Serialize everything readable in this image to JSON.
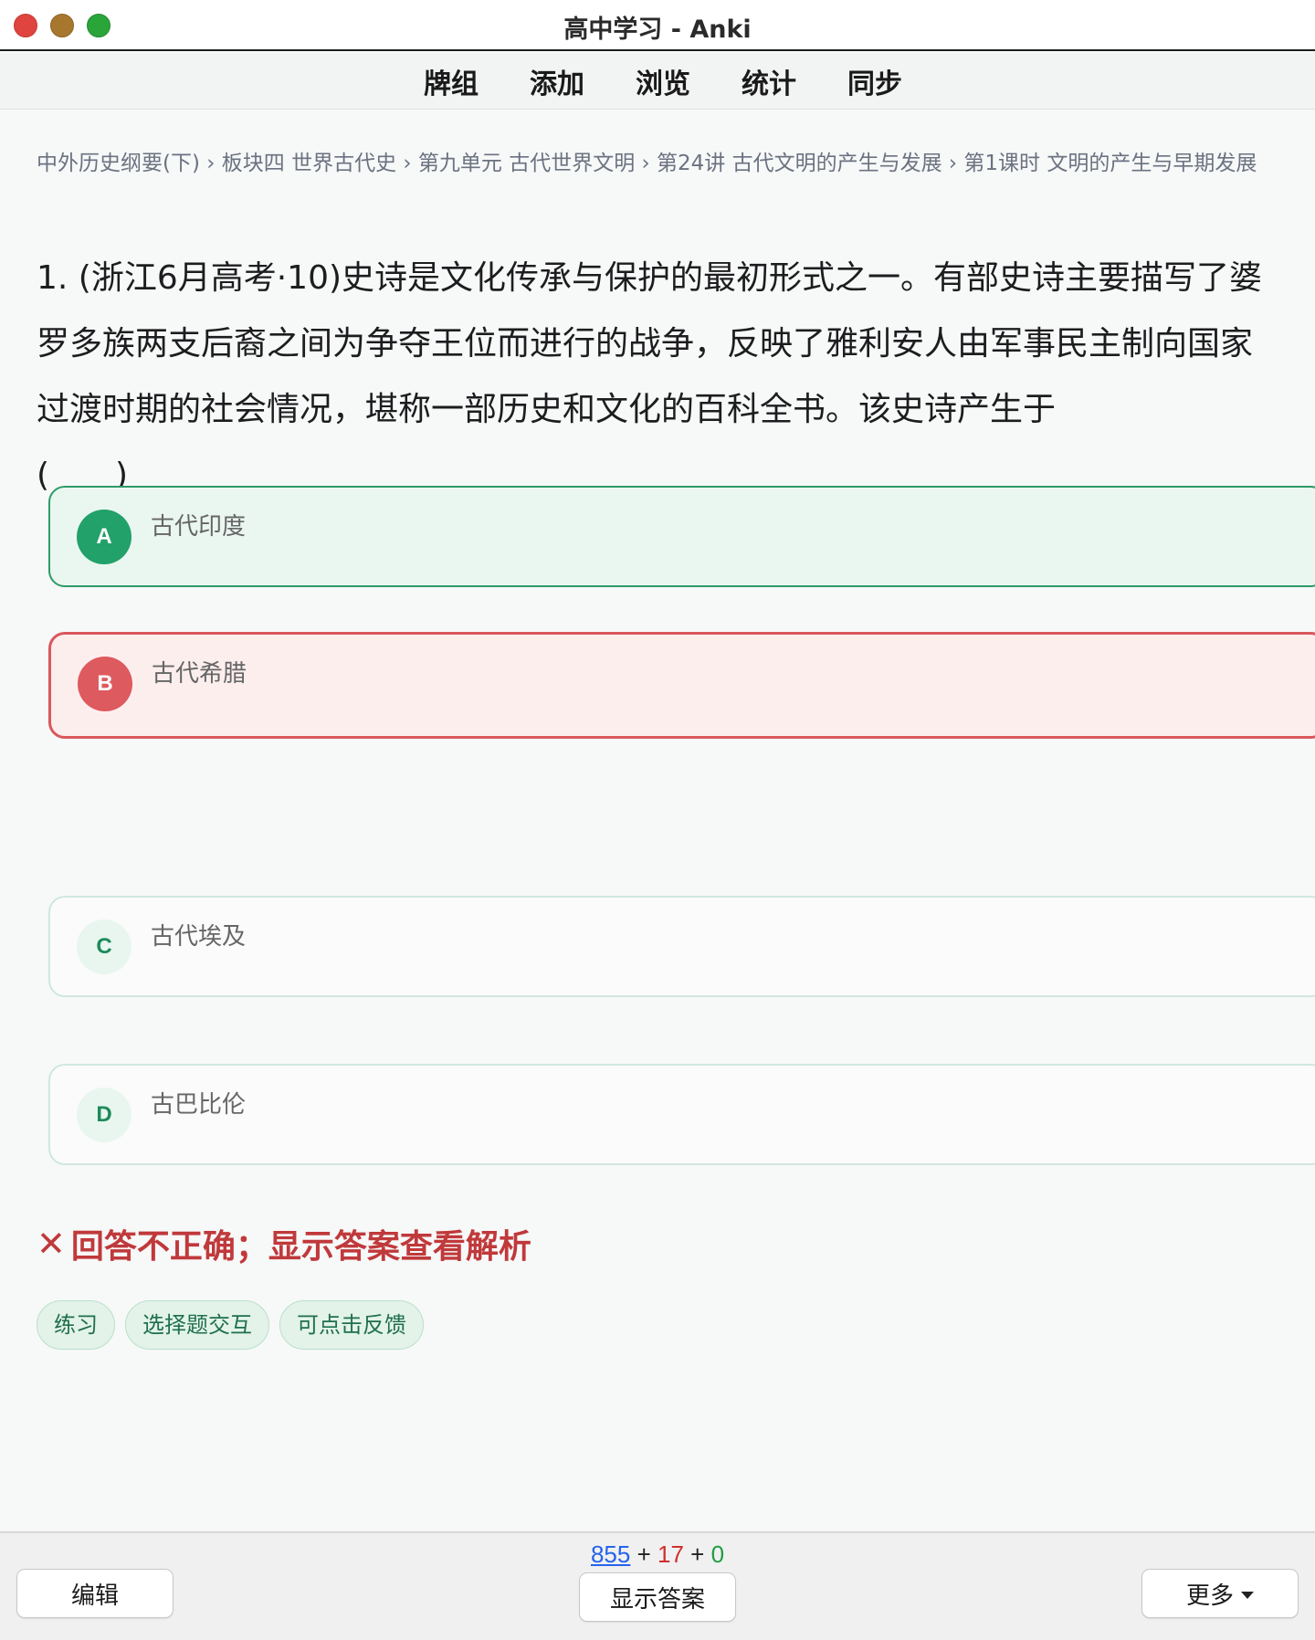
{
  "window": {
    "title": "高中学习 - Anki"
  },
  "toolbar": {
    "items": [
      "牌组",
      "添加",
      "浏览",
      "统计",
      "同步"
    ]
  },
  "breadcrumb": "中外历史纲要(下) › 板块四 世界古代史 › 第九单元 古代世界文明 › 第24讲 古代文明的产生与发展 › 第1课时 文明的产生与早期发展",
  "question": {
    "text": "1.  (浙江6月高考·10)史诗是文化传承与保护的最初形式之一。有部史诗主要描写了婆罗多族两支后裔之间为争夺王位而进行的战争，反映了雅利安人由军事民主制向国家过渡时期的社会情况，堪称一部历史和文化的百科全书。该史诗产生于",
    "blank": "(  )"
  },
  "options": [
    {
      "letter": "A",
      "text": "古代印度",
      "state": "correct"
    },
    {
      "letter": "B",
      "text": "古代希腊",
      "state": "wrong"
    },
    {
      "letter": "C",
      "text": "古代埃及",
      "state": "neutral"
    },
    {
      "letter": "D",
      "text": "古巴比伦",
      "state": "neutral"
    }
  ],
  "feedback": {
    "icon": "✕",
    "text": "回答不正确；显示答案查看解析",
    "color": "#c0393b"
  },
  "tags": [
    "练习",
    "选择题交互",
    "可点击反馈"
  ],
  "bottom": {
    "count_new": "855",
    "plus1": " + ",
    "count_learn": "17",
    "plus2": " + ",
    "count_review": "0",
    "edit_label": "编辑",
    "show_answer_label": "显示答案",
    "more_label": "更多"
  },
  "colors": {
    "correct_border": "#2e9a69",
    "wrong_border": "#d9575c",
    "new_count": "#2563eb",
    "learn_count": "#d12f2f",
    "review_count": "#1f9d44"
  }
}
